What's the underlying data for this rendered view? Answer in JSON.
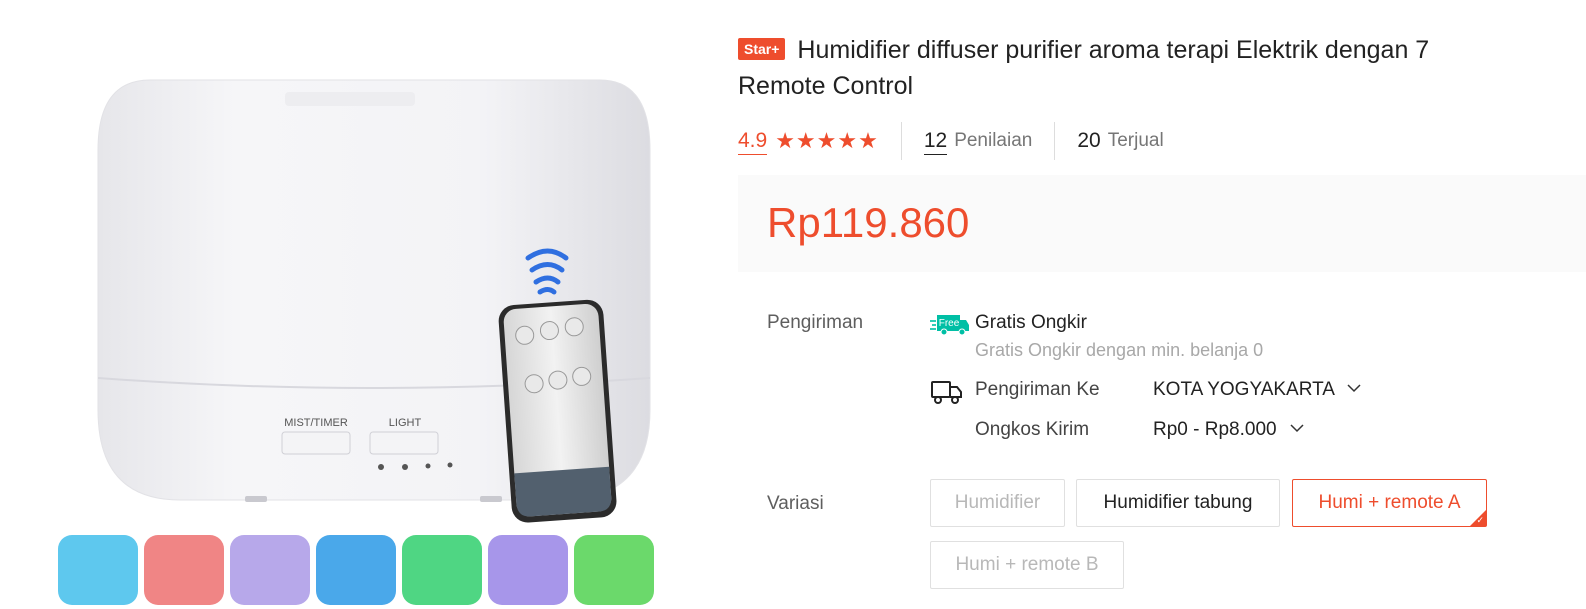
{
  "product": {
    "badge": "Star+",
    "title_line1": "Humidifier diffuser purifier aroma terapi Elektrik dengan 7",
    "title_line2": "Remote Control",
    "rating": "4.9",
    "stars": "★★★★★",
    "review_count": "12",
    "review_label": "Penilaian",
    "sold_count": "20",
    "sold_label": "Terjual",
    "price": "Rp119.860"
  },
  "image": {
    "button_mist": "MIST/TIMER",
    "button_light": "LIGHT",
    "thumb_colors": [
      "#5ec8ee",
      "#f08585",
      "#b7a8ea",
      "#4aa8ea",
      "#4fd683",
      "#a796ea",
      "#6bd96b"
    ]
  },
  "shipping": {
    "label": "Pengiriman",
    "free_badge": "Free",
    "gratis_title": "Gratis Ongkir",
    "gratis_sub": "Gratis Ongkir dengan min. belanja 0",
    "ship_to_label": "Pengiriman Ke",
    "ship_to_value": "KOTA YOGYAKARTA",
    "cost_label": "Ongkos Kirim",
    "cost_value": "Rp0 - Rp8.000"
  },
  "variation": {
    "label": "Variasi",
    "options": [
      {
        "label": "Humidifier",
        "state": "disabled"
      },
      {
        "label": "Humidifier tabung",
        "state": "normal"
      },
      {
        "label": "Humi + remote A",
        "state": "selected"
      },
      {
        "label": "Humi + remote B",
        "state": "disabled"
      }
    ]
  },
  "colors": {
    "accent": "#ee4d2d",
    "free_green": "#00bfa5"
  }
}
